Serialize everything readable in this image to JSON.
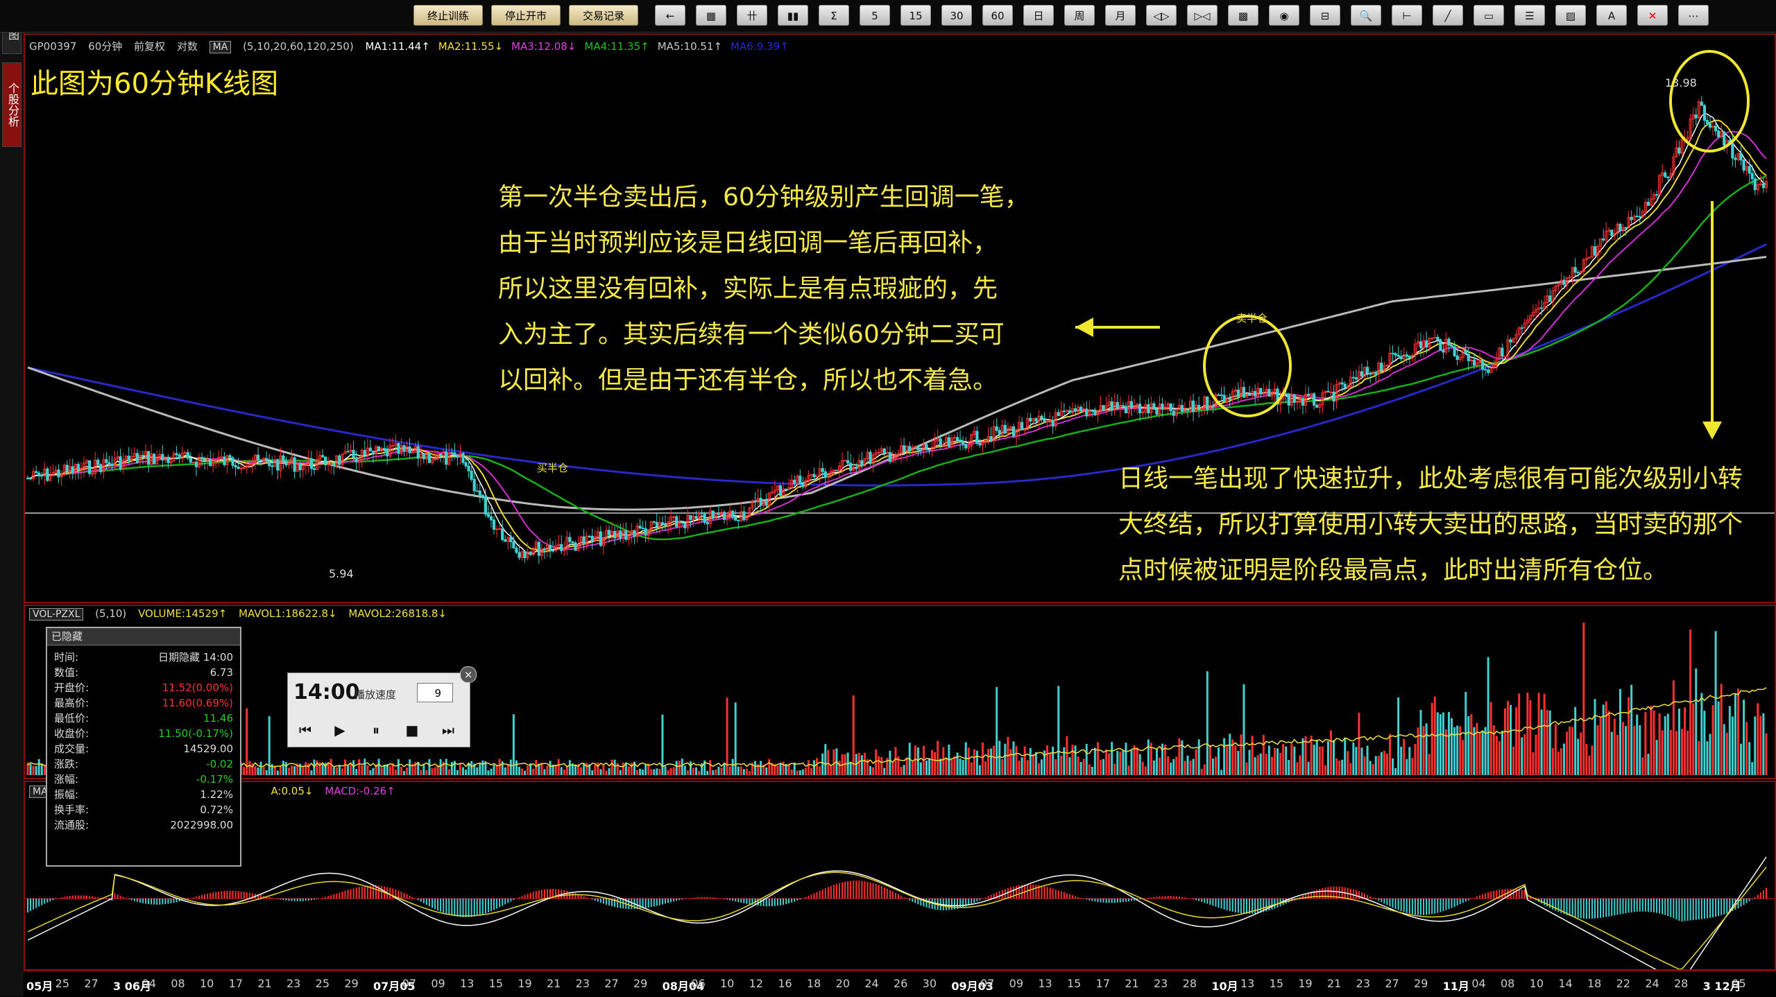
{
  "toolbar": {
    "buttons": [
      "终止训练",
      "停止开市",
      "交易记录"
    ],
    "icons": [
      "back-arrow",
      "grid",
      "fib",
      "bars",
      "sigma",
      "5",
      "15",
      "30",
      "60",
      "日",
      "周",
      "月",
      "pan-left",
      "pan-right",
      "zoom-fit",
      "eye",
      "split",
      "search",
      "cursor",
      "line",
      "rect",
      "text",
      "color",
      "A",
      "close",
      "more"
    ]
  },
  "left_tabs": [
    "主图",
    "个股分析"
  ],
  "main": {
    "code": "GP00397",
    "period": "60分钟",
    "adjust": "前复权",
    "scale": "对数",
    "indicator": "MA",
    "params": "(5,10,20,60,120,250)",
    "ma": [
      {
        "label": "MA1:11.44↑",
        "color": "#ffffff"
      },
      {
        "label": "MA2:11.55↓",
        "color": "#f0e040"
      },
      {
        "label": "MA3:12.08↓",
        "color": "#e040e0"
      },
      {
        "label": "MA4:11.35↑",
        "color": "#20c020"
      },
      {
        "label": "MA5:10.51↑",
        "color": "#c8c8c8"
      },
      {
        "label": "MA6:9.39↑",
        "color": "#2828d0"
      }
    ],
    "title": "此图为60分钟K线图",
    "annotation_left": [
      "第一次半仓卖出后，60分钟级别产生回调一笔，",
      "由于当时预判应该是日线回调一笔后再回补，",
      "所以这里没有回补，实际上是有点瑕疵的，先",
      "入为主了。其实后续有一个类似60分钟二买可",
      "以回补。但是由于还有半仓，所以也不着急。"
    ],
    "annotation_right": [
      "日线一笔出现了快速拉升，此处考虑很有可能次级别小转",
      "大终结，所以打算使用小转大卖出的思路，当时卖的那个",
      "点时候被证明是阶段最高点，此时出清所有仓位。"
    ],
    "label_high": "13.98",
    "label_low": "5.94",
    "label_buy": "买半仓",
    "label_sell": "卖半仓"
  },
  "volume": {
    "indicator": "VOL-PZXL",
    "params": "(5,10)",
    "volume": "VOLUME:14529↑",
    "mavol1": "MAVOL1:18622.8↓",
    "mavol2": "MAVOL2:26818.8↓"
  },
  "macd": {
    "indicator": "MA",
    "dea": "A:0.05↓",
    "macd": "MACD:-0.26↑"
  },
  "infobox": {
    "title": "已隐藏",
    "rows": [
      {
        "label": "时间",
        "value": "日期隐藏 14:00",
        "color": "#dddddd"
      },
      {
        "label": "数值",
        "value": "6.73",
        "color": "#dddddd"
      },
      {
        "label": "开盘价",
        "value": "11.52(0.00%)",
        "color": "#ff3030"
      },
      {
        "label": "最高价",
        "value": "11.60(0.69%)",
        "color": "#ff3030"
      },
      {
        "label": "最低价",
        "value": "11.46",
        "color": "#20d020"
      },
      {
        "label": "收盘价",
        "value": "11.50(-0.17%)",
        "color": "#20d020"
      },
      {
        "label": "成交量",
        "value": "14529.00",
        "color": "#dddddd"
      },
      {
        "label": "涨跌",
        "value": "-0.02",
        "color": "#20d020"
      },
      {
        "label": "涨幅",
        "value": "-0.17%",
        "color": "#20d020"
      },
      {
        "label": "振幅",
        "value": "1.22%",
        "color": "#dddddd"
      },
      {
        "label": "换手率",
        "value": "0.72%",
        "color": "#dddddd"
      },
      {
        "label": "流通股",
        "value": "2022998.00",
        "color": "#dddddd"
      }
    ]
  },
  "player": {
    "time": "14:00",
    "speed_label": "播放速度",
    "speed": "9"
  },
  "dates": [
    {
      "t": "05月",
      "b": true
    },
    "25",
    "27",
    {
      "t": "3 06月",
      "b": true
    },
    "04",
    "08",
    "10",
    "17",
    "21",
    "23",
    "25",
    "29",
    {
      "t": "07月05",
      "b": true
    },
    "07",
    "09",
    "13",
    "15",
    "19",
    "21",
    "23",
    "27",
    "29",
    {
      "t": "08月04",
      "b": true
    },
    "06",
    "10",
    "12",
    "16",
    "18",
    "20",
    "24",
    "26",
    "30",
    {
      "t": "09月03",
      "b": true
    },
    "07",
    "09",
    "13",
    "15",
    "17",
    "21",
    "23",
    "28",
    {
      "t": "10月",
      "b": true
    },
    "13",
    "15",
    "19",
    "21",
    "23",
    "27",
    "29",
    {
      "t": "11月",
      "b": true
    },
    "04",
    "08",
    "10",
    "14",
    "18",
    "22",
    "24",
    "28",
    {
      "t": "3 12月",
      "b": true
    },
    "05"
  ]
}
